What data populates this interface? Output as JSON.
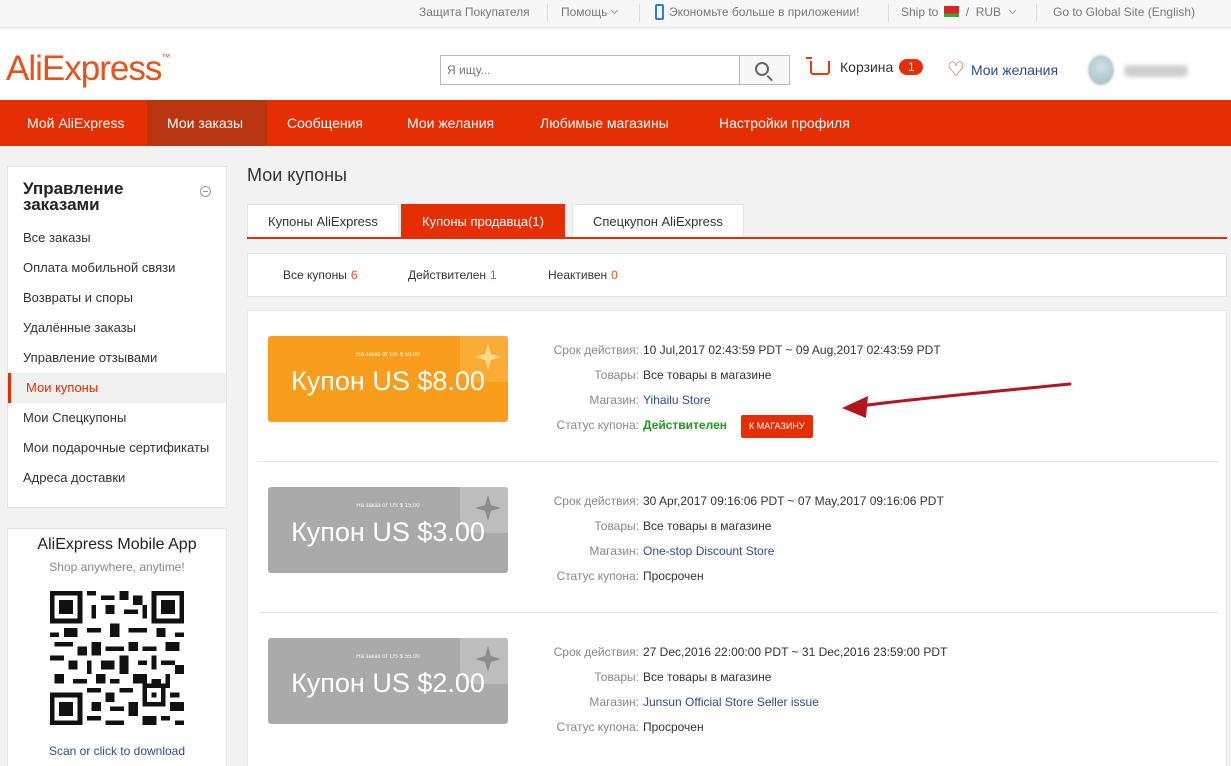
{
  "topbar": {
    "buyer_protection": "Защита Покупателя",
    "help": "Помощь",
    "app_promo": "Экономьте больше в приложении!",
    "ship_to": "Ship to",
    "currency_sep": "/",
    "currency": "RUB",
    "global_site": "Go to Global Site (English)"
  },
  "header": {
    "logo": "AliExpress",
    "logo_tm": "™",
    "search_placeholder": "Я ищу...",
    "cart_label": "Корзина",
    "cart_count": "1",
    "wishlist_label": "Мои желания"
  },
  "nav": {
    "items": [
      {
        "label": "Мой AliExpress"
      },
      {
        "label": "Мои заказы"
      },
      {
        "label": "Сообщения"
      },
      {
        "label": "Мои желания"
      },
      {
        "label": "Любимые магазины"
      },
      {
        "label": "Настройки профиля"
      }
    ]
  },
  "sidebar": {
    "title": "Управление заказами",
    "items": [
      {
        "label": "Все заказы"
      },
      {
        "label": "Оплата мобильной связи"
      },
      {
        "label": "Возвраты и споры"
      },
      {
        "label": "Удалённые заказы"
      },
      {
        "label": "Управление отзывами"
      },
      {
        "label": "Мои купоны"
      },
      {
        "label": "Мои Спецкупоны"
      },
      {
        "label": "Мои подарочные сертификаты"
      },
      {
        "label": "Адреса доставки"
      }
    ]
  },
  "app_promo": {
    "title": "AliExpress Mobile App",
    "subtitle": "Shop anywhere, anytime!",
    "link": "Scan or click to download"
  },
  "main": {
    "title": "Мои купоны",
    "tabs": [
      {
        "label": "Купоны AliExpress"
      },
      {
        "label": "Купоны продавца(1)"
      },
      {
        "label": "Спецкупон AliExpress"
      }
    ],
    "filters": [
      {
        "label": "Все купоны",
        "count": "6"
      },
      {
        "label": "Действителен",
        "count": "1"
      },
      {
        "label": "Неактивен",
        "count": "0"
      }
    ],
    "labels": {
      "validity": "Срок действия:",
      "goods": "Товары:",
      "store": "Магазин:",
      "status": "Статус купона:"
    },
    "shop_button": "К МАГАЗИНУ",
    "coupons": [
      {
        "min_order": "На заказ от US $ 59.00",
        "amount": "Купон US $8.00",
        "validity": "10 Jul,2017 02:43:59 PDT ~ 09 Aug,2017 02:43:59 PDT",
        "goods": "Все товары в магазине",
        "store": "Yihailu Store",
        "status": "Действителен",
        "state": "valid"
      },
      {
        "min_order": "На заказ от US $ 15.00",
        "amount": "Купон US $3.00",
        "validity": "30 Apr,2017 09:16:06 PDT ~ 07 May,2017 09:16:06 PDT",
        "goods": "Все товары в магазине",
        "store": "One-stop Discount Store",
        "status": "Просрочен",
        "state": "expired"
      },
      {
        "min_order": "На заказ от US $ 55.00",
        "amount": "Купон US $2.00",
        "validity": "27 Dec,2016 22:00:00 PDT ~ 31 Dec,2016 23:59:00 PDT",
        "goods": "Все товары в магазине",
        "store": "Junsun Official Store Seller issue",
        "status": "Просрочен",
        "state": "expired"
      }
    ]
  },
  "colors": {
    "brand_red": "#e62e04",
    "coupon_orange": "#f99d1c",
    "coupon_gray": "#aaaaaa",
    "valid_green": "#1a9c1a",
    "annotation_arrow": "#b3161e"
  }
}
